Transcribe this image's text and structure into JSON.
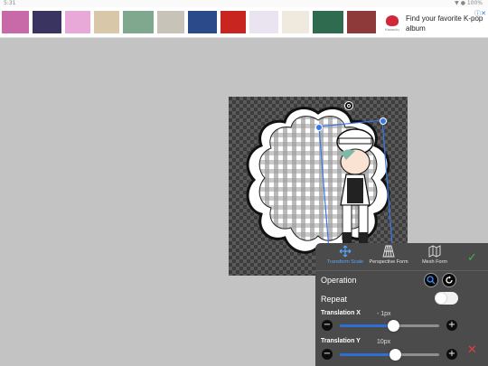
{
  "statusbar": {
    "time": "5:31",
    "system": "▼ ● 100%"
  },
  "ad": {
    "thumbnails": [
      {
        "color": "#c86aa8"
      },
      {
        "color": "#3a3460"
      },
      {
        "color": "#e8a9d8"
      },
      {
        "color": "#d9c7a9"
      },
      {
        "color": "#7fa88f"
      },
      {
        "color": "#c7c3b8"
      },
      {
        "color": "#2b4a8a"
      },
      {
        "color": "#c82420"
      },
      {
        "color": "#e9e4ef"
      },
      {
        "color": "#efe9de"
      },
      {
        "color": "#2f6b4e"
      },
      {
        "color": "#8e3a3a"
      }
    ],
    "brand": "Ktown4u",
    "text": "Find your favorite K-pop album",
    "close_icon": "ad-choices-icon"
  },
  "tool": {
    "modes": [
      {
        "label": "Transform Scale",
        "icon": "move-arrows-icon",
        "active": true
      },
      {
        "label": "Perspective Form",
        "icon": "perspective-grid-icon",
        "active": false
      },
      {
        "label": "Mesh Form",
        "icon": "mesh-map-icon",
        "active": false
      }
    ],
    "confirm_icon": "check-icon",
    "cancel_icon": "close-x-icon",
    "operation_label": "Operation",
    "repeat_label": "Repeat",
    "repeat_on": true,
    "translation_x": {
      "label": "Translation X",
      "value": "- 1px",
      "level": 0.54
    },
    "translation_y": {
      "label": "Translation Y",
      "value": "10px",
      "level": 0.56
    }
  },
  "colors": {
    "panel": "#4b4b4b",
    "accent": "#2d6fd6",
    "confirm": "#3fb24a",
    "cancel": "#e04040",
    "background": "#c3c3c3"
  }
}
